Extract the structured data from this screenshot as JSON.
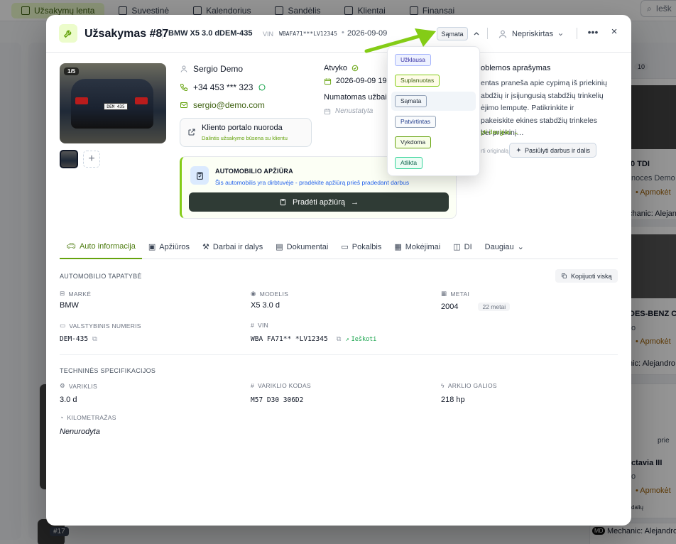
{
  "bg": {
    "nav": [
      "Užsakymų lenta",
      "Suvestinė",
      "Kalendorius",
      "Sandėlis",
      "Klientai",
      "Finansai"
    ],
    "search": "Iešk",
    "right_texts": [
      "10",
      "0 TDI",
      "noces Demo",
      "• Apmokėt",
      "chanic: Alejandro",
      "DES-BENZ C 3",
      "o",
      "• Apmokėt",
      "nic: Alejandro",
      "prie",
      "ctavia III",
      "o",
      "• Apmokėt",
      "dalių",
      "Mechanic: Alejandro"
    ],
    "card_num": "#17",
    "mech_badge": "MD"
  },
  "header": {
    "title": "Užsakymas #87",
    "model": "BMW X5 3.0 d",
    "plate": "DEM-435",
    "vin_label": "VIN",
    "vin": "WBAFA71***LV12345",
    "date": "2026-09-09",
    "status": "Sąmata",
    "assignee": "Nepriskirtas",
    "more": "•••",
    "close": "×"
  },
  "photo": {
    "count": "1/5",
    "plate": "DEM 435"
  },
  "customer": {
    "name": "Sergio Demo",
    "phone": "+34 453 *** 323",
    "email": "sergio@demo.com",
    "portal_title": "Kliento portalo nuoroda",
    "portal_sub": "Dalintis užsakymo būsena su klientu"
  },
  "arrival": {
    "label": "Atvyko",
    "value": "2026-09-09 19:",
    "planned_label": "Numatomas užbaig",
    "planned_value": "Nenustatyta"
  },
  "problem": {
    "title": "oblemos aprašymas",
    "text": "entas praneša apie cypimą iš priekinių abdžių ir įsijungusią stabdžių trinkelių ėjimo lemputę. Patikrinkite ir pakeiskite ekines stabdžių trinkeles bei priekinį…",
    "more": "yti daugiau",
    "orig": "rti originalą",
    "suggest": "Pasiūlyti darbus ir dalis"
  },
  "inspection": {
    "title": "AUTOMOBILIO APŽIŪRA",
    "sub": "Šis automobilis yra dirbtuvėje - pradėkite apžiūrą prieš pradedant darbus",
    "button": "Pradėti apžiūrą"
  },
  "tabs": [
    "Auto informacija",
    "Apžiūros",
    "Darbai ir dalys",
    "Dokumentai",
    "Pokalbis",
    "Mokėjimai",
    "DI",
    "Daugiau"
  ],
  "identity": {
    "title": "AUTOMOBILIO TAPATYBĖ",
    "copy_all": "Kopijuoti viską",
    "make_label": "MARKĖ",
    "make": "BMW",
    "model_label": "MODELIS",
    "model": "X5 3.0 d",
    "year_label": "METAI",
    "year": "2004",
    "age": "22 metai",
    "plate_label": "VALSTYBINIS NUMERIS",
    "plate": "DEM-435",
    "vin_label": "VIN",
    "vin": "WBA FA71** *LV12345",
    "lookup": "Ieškoti"
  },
  "specs": {
    "title": "TECHNINĖS SPECIFIKACIJOS",
    "engine_label": "VARIKLIS",
    "engine": "3.0 d",
    "code_label": "VARIKLIO KODAS",
    "code": "M57 D30 306D2",
    "hp_label": "ARKLIO GALIOS",
    "hp": "218 hp",
    "km_label": "KILOMETRAŽAS",
    "km": "Nenurodyta"
  },
  "dropdown": [
    {
      "label": "Užklausa",
      "bg": "#eef2ff",
      "border": "#a5b4fc",
      "color": "#3730a3"
    },
    {
      "label": "Suplanuotas",
      "bg": "#fefce8",
      "border": "#84cc16",
      "color": "#3f6212"
    },
    {
      "label": "Sąmata",
      "bg": "#f1f5f9",
      "border": "#94a3b8",
      "color": "#1f2937"
    },
    {
      "label": "Patvirtintas",
      "bg": "#f8fafc",
      "border": "#94a3b8",
      "color": "#1e3a8a"
    },
    {
      "label": "Vykdoma",
      "bg": "#f7fee7",
      "border": "#65a30d",
      "color": "#1f2937"
    },
    {
      "label": "Atlikta",
      "bg": "#ecfdf5",
      "border": "#34d399",
      "color": "#065f46"
    }
  ],
  "colors": {
    "accent": "#65a30d",
    "arrow": "#84cc16",
    "dark_button": "#2f3b35"
  }
}
